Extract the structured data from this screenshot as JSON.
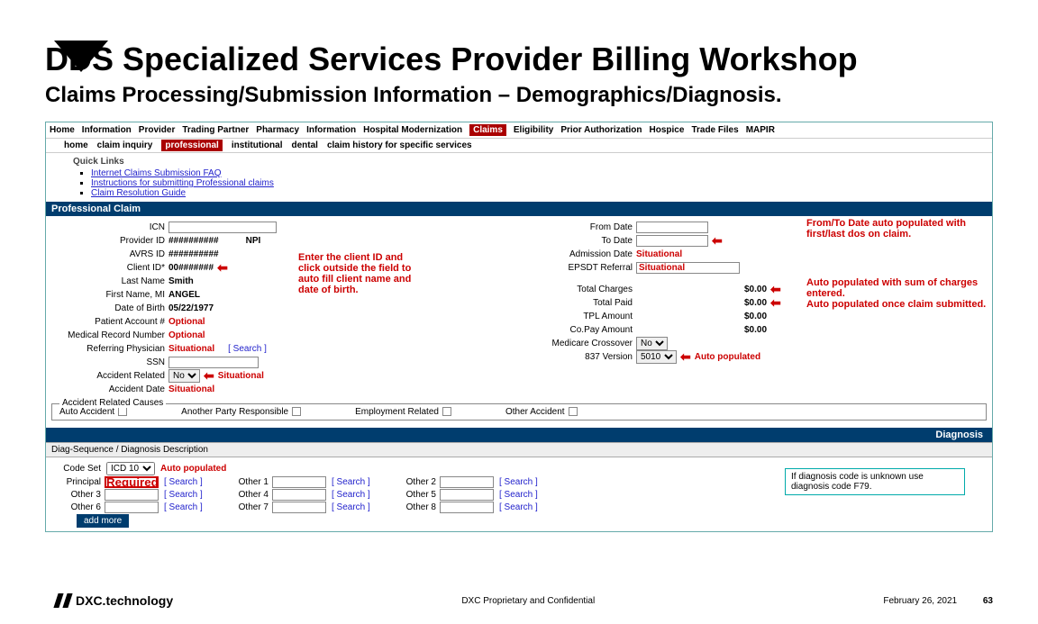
{
  "title": "DDS Specialized Services Provider Billing Workshop",
  "subtitle": "Claims Processing/Submission Information – Demographics/Diagnosis.",
  "topnav": [
    "Home",
    "Information",
    "Provider",
    "Trading Partner",
    "Pharmacy",
    "Information",
    "Hospital Modernization",
    "Claims",
    "Eligibility",
    "Prior Authorization",
    "Hospice",
    "Trade Files",
    "MAPIR"
  ],
  "topnav_active": "Claims",
  "subnav": [
    "home",
    "claim inquiry",
    "professional",
    "institutional",
    "dental",
    "claim history for specific services"
  ],
  "subnav_active": "professional",
  "quicklinks_title": "Quick Links",
  "quicklinks": [
    "Internet Claims Submission FAQ",
    "Instructions for submitting Professional claims",
    "Claim Resolution Guide"
  ],
  "section_professional": "Professional Claim",
  "left": {
    "icn": "ICN",
    "provider_id": "Provider ID",
    "provider_id_val": "##########",
    "npi": "NPI",
    "avrs_id": "AVRS ID",
    "avrs_id_val": "##########",
    "client_id": "Client ID*",
    "client_id_val": "00#######",
    "last_name": "Last Name",
    "last_name_val": "Smith",
    "first_name": "First Name, MI",
    "first_name_val": "ANGEL",
    "dob": "Date of Birth",
    "dob_val": "05/22/1977",
    "patient_acct": "Patient Account #",
    "patient_acct_val": "Optional",
    "mrn": "Medical Record Number",
    "mrn_val": "Optional",
    "ref_phys": "Referring Physician",
    "ref_phys_val": "Situational",
    "search": "[ Search ]",
    "ssn": "SSN",
    "accident_related": "Accident Related",
    "accident_related_val": "No",
    "situational": "Situational",
    "accident_date": "Accident Date",
    "accident_date_val": "Situational"
  },
  "right": {
    "from_date": "From Date",
    "to_date": "To Date",
    "admission_date": "Admission Date",
    "admission_date_val": "Situational",
    "epsdt": "EPSDT Referral",
    "epsdt_val": "Situational",
    "total_charges": "Total Charges",
    "total_charges_val": "$0.00",
    "total_paid": "Total Paid",
    "total_paid_val": "$0.00",
    "tpl": "TPL Amount",
    "tpl_val": "$0.00",
    "copay": "Co.Pay Amount",
    "copay_val": "$0.00",
    "medicare": "Medicare Crossover",
    "medicare_val": "No",
    "version": "837 Version",
    "version_val": "5010",
    "auto_pop": "Auto populated"
  },
  "annotations": {
    "client": "Enter the client ID and click outside the field to auto fill client name and date of birth.",
    "dates": "From/To Date auto populated with first/last dos on claim.",
    "charges": "Auto populated with sum of charges entered.",
    "submitted": "Auto populated once claim submitted."
  },
  "accident_title": "Accident Related Causes",
  "accident": {
    "auto": "Auto Accident",
    "other_party": "Another Party Responsible",
    "employment": "Employment Related",
    "other": "Other Accident"
  },
  "diagnosis_header": "Diagnosis",
  "diag_sub": "Diag-Sequence /    Diagnosis   Description",
  "code_set_lbl": "Code Set",
  "code_set_val": "ICD 10",
  "auto_pop2": "Auto populated",
  "diag_rows": [
    {
      "a": "Principal",
      "b": "Other 1",
      "c": "Other 2"
    },
    {
      "a": "Other 3",
      "b": "Other 4",
      "c": "Other 5"
    },
    {
      "a": "Other 6",
      "b": "Other 7",
      "c": "Other 8"
    }
  ],
  "principal_val": "Required",
  "search2": "[ Search ]",
  "add_more": "add more",
  "diag_note": "If diagnosis code is unknown use diagnosis code F79.",
  "footer": {
    "brand": "DXC.technology",
    "center": "DXC Proprietary and Confidential",
    "date": "February 26, 2021",
    "page": "63"
  }
}
